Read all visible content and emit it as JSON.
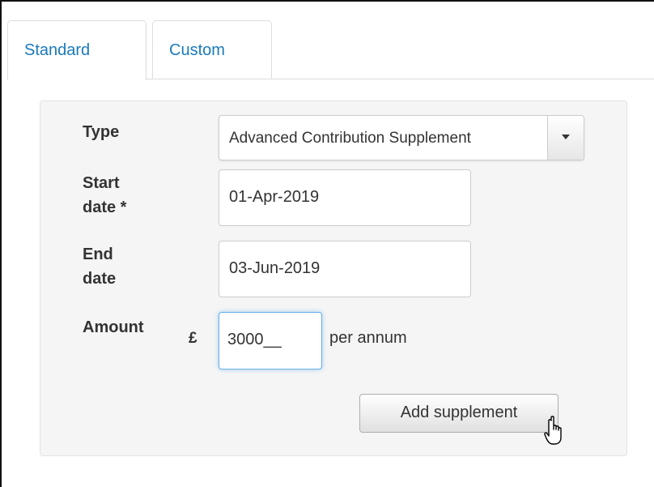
{
  "tabs": {
    "standard": "Standard",
    "custom": "Custom"
  },
  "form": {
    "type_label": "Type",
    "type_value": "Advanced Contribution Supplement",
    "start_label_line1": "Start",
    "start_label_line2": "date *",
    "start_value": "01-Apr-2019",
    "end_label_line1": "End",
    "end_label_line2": "date",
    "end_value": "03-Jun-2019",
    "amount_label": "Amount",
    "currency_symbol": "£",
    "amount_value": "3000__",
    "amount_suffix": "per annum",
    "add_button": "Add supplement"
  },
  "colors": {
    "tab_text": "#1a7ab8",
    "panel_bg": "#f5f5f5",
    "focus_border": "#66afe9"
  },
  "icons": {
    "select_caret": "chevron-down-icon",
    "pointer": "hand-pointer-icon"
  }
}
